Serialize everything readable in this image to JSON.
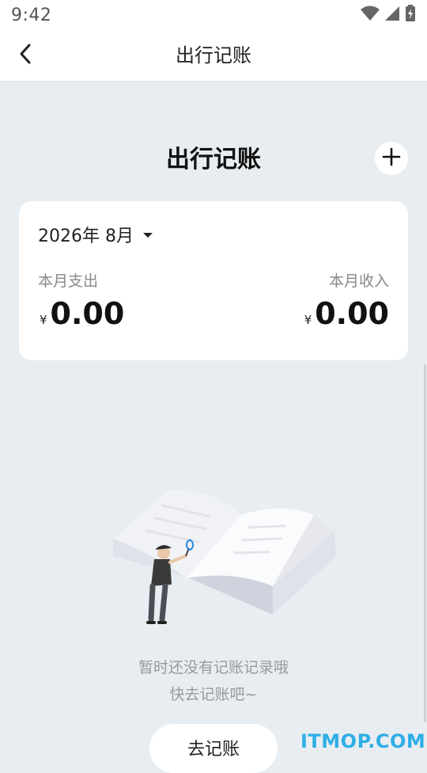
{
  "status_bar": {
    "time": "9:42"
  },
  "header": {
    "title": "出行记账"
  },
  "main": {
    "page_title": "出行记账",
    "summary_card": {
      "month_label": "2026年 8月",
      "expense_label": "本月支出",
      "expense_currency": "¥",
      "expense_amount": "0.00",
      "income_label": "本月收入",
      "income_currency": "¥",
      "income_amount": "0.00"
    },
    "empty_state": {
      "line1": "暂时还没有记账记录哦",
      "line2": "快去记账吧~",
      "button_label": "去记账"
    }
  },
  "watermark": "ITMOP.COM",
  "icons": {
    "back": "chevron-left-icon",
    "add": "plus-icon",
    "dropdown": "caret-down-icon",
    "wifi": "wifi-icon",
    "signal": "signal-icon",
    "battery": "battery-icon"
  },
  "colors": {
    "background": "#e8edf1",
    "card": "#ffffff",
    "watermark": "#2eaee6"
  }
}
